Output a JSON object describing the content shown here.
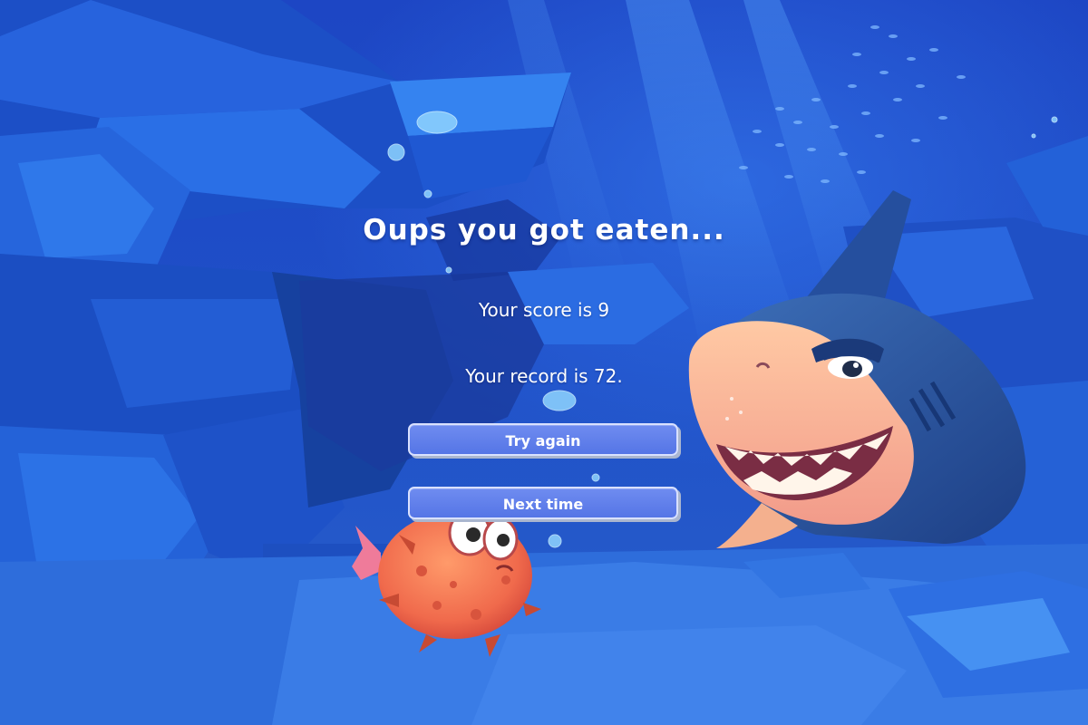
{
  "game_over": {
    "title": "Oups you got eaten...",
    "score_text": "Your score is 9",
    "record_text": "Your record is 72."
  },
  "buttons": {
    "try_again": "Try again",
    "next_time": "Next time"
  },
  "colors": {
    "ocean_deep": "#1b3fb0",
    "ocean_light": "#2f6ae0",
    "button_fill": "#6580ec",
    "button_border": "#d9e1ff",
    "text": "#ffffff"
  },
  "characters": {
    "predator": "shark",
    "player": "pufferfish"
  }
}
